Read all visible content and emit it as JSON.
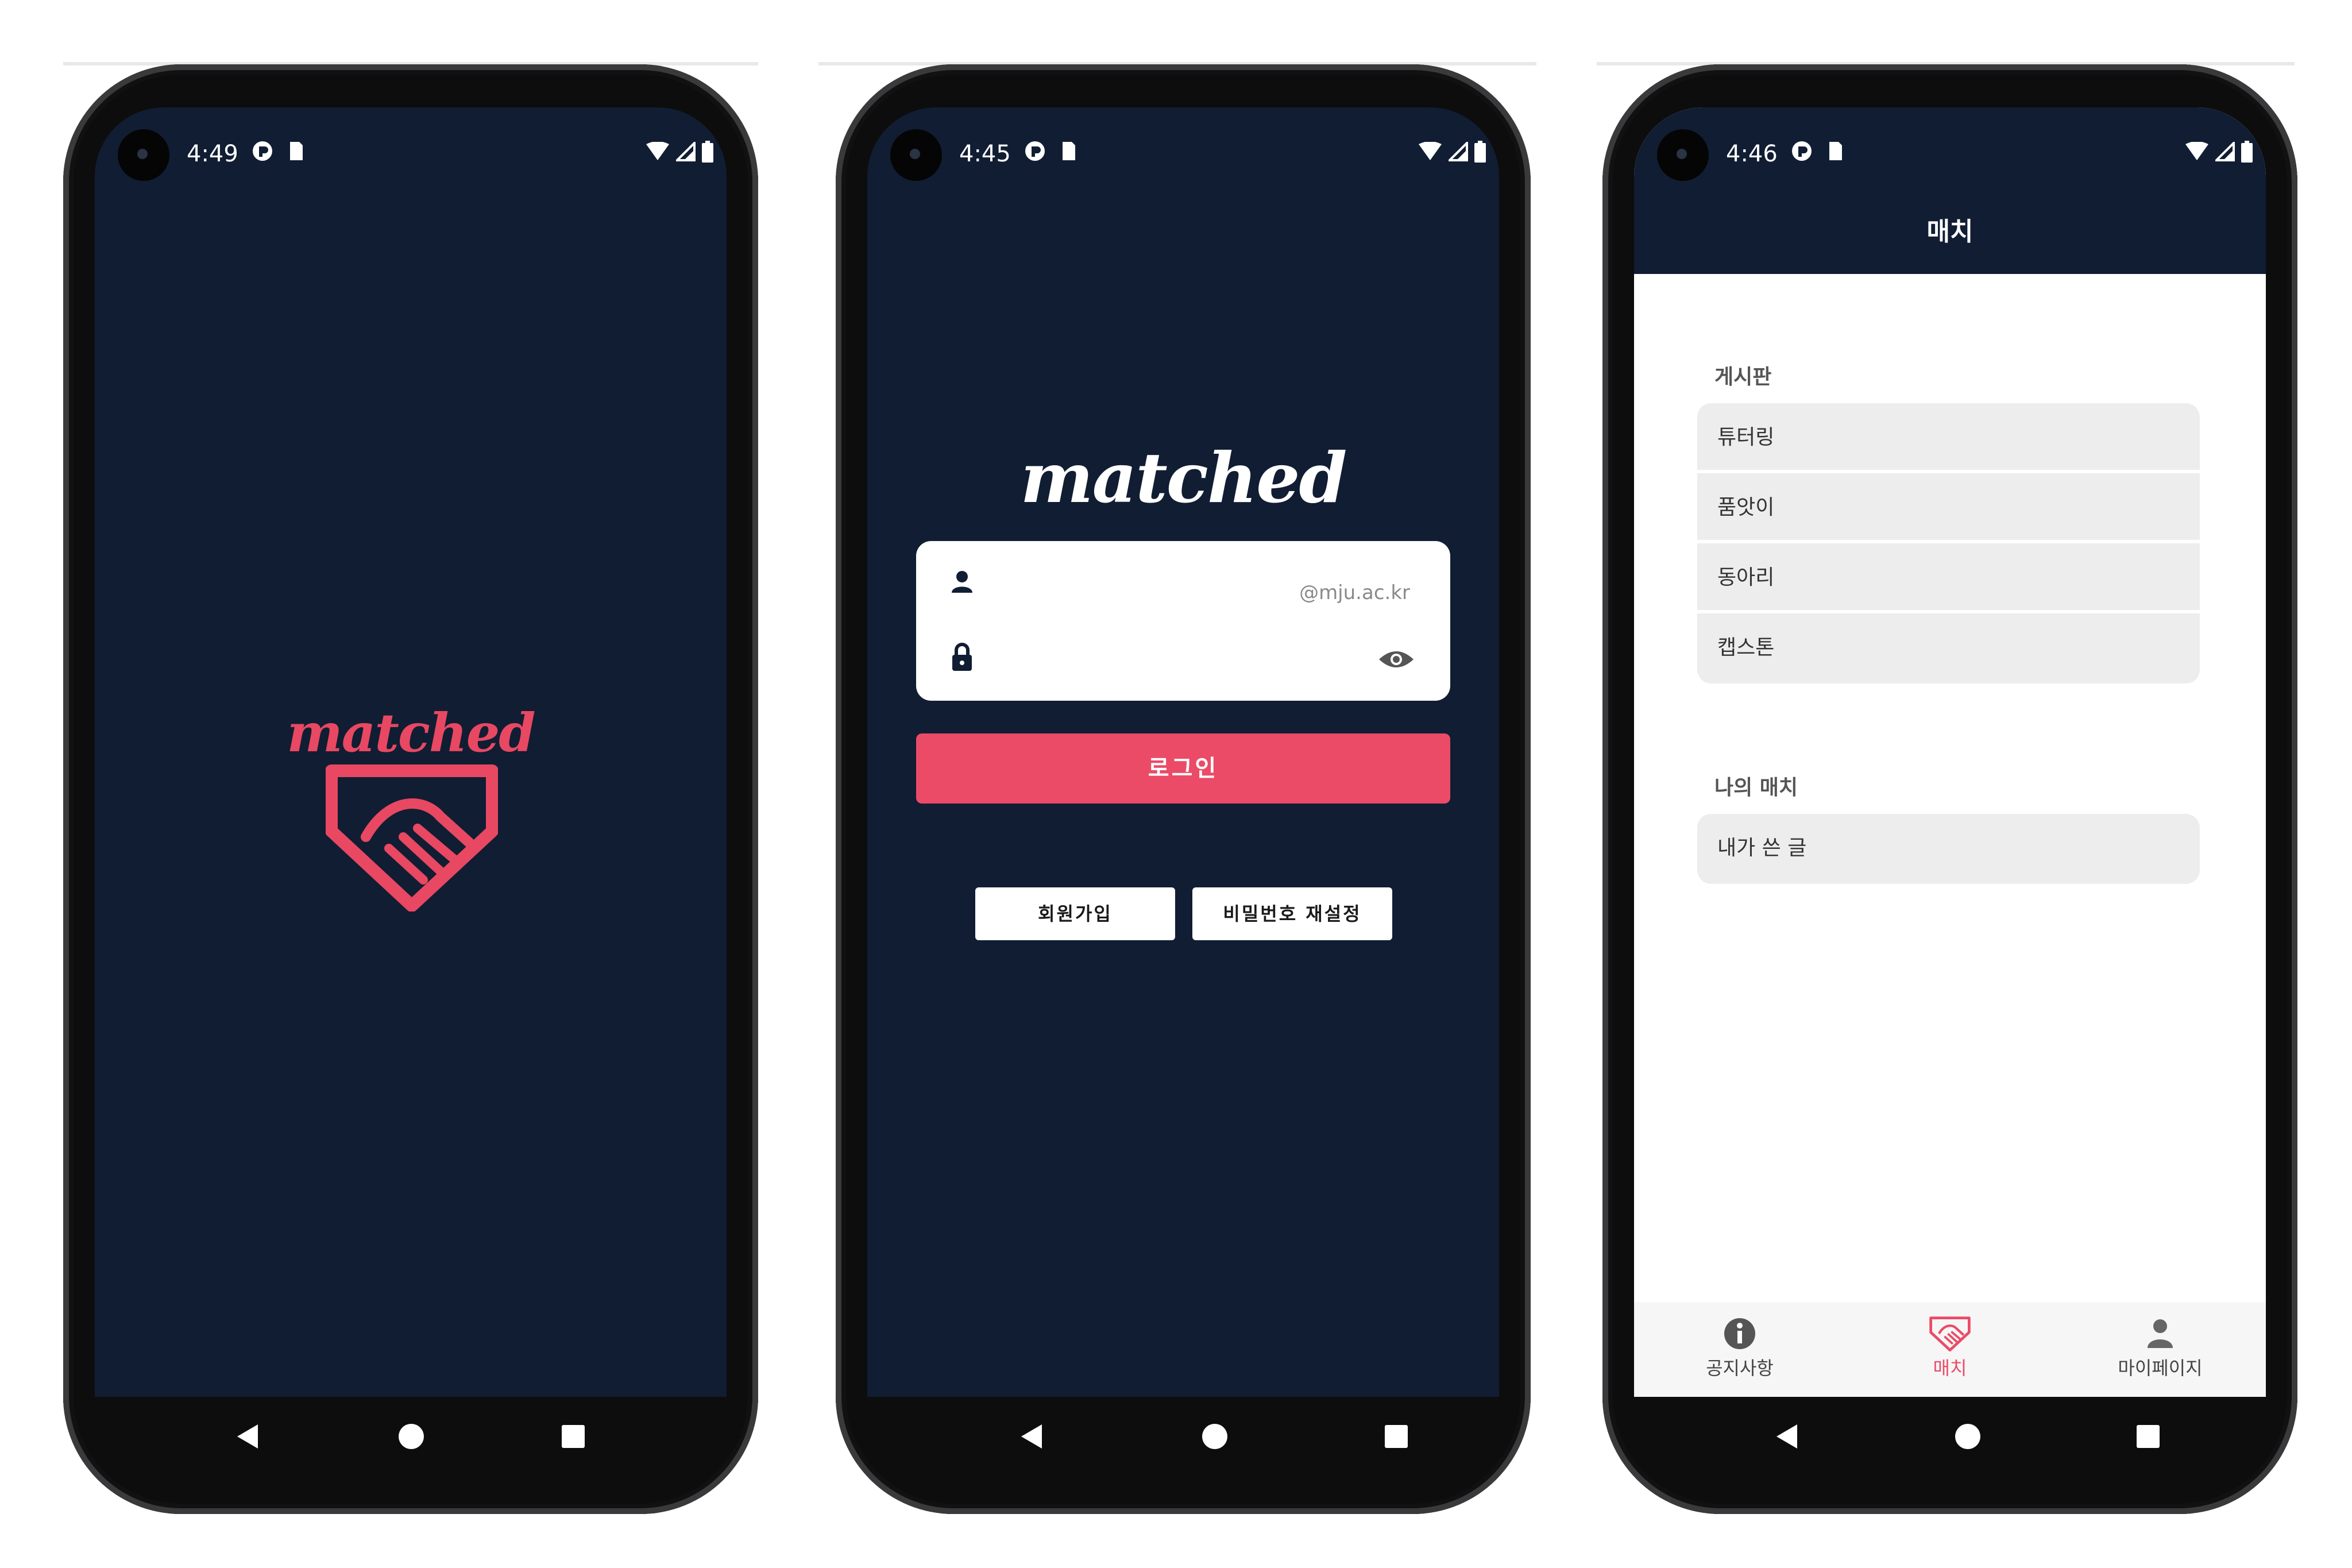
{
  "screens": [
    {
      "status": {
        "time": "4:49"
      },
      "splash": {
        "logo_text": "matched"
      }
    },
    {
      "status": {
        "time": "4:45"
      },
      "login": {
        "logo_text": "matched",
        "email_hint": "@mju.ac.kr",
        "login_label": "로그인",
        "signup_label": "회원가입",
        "reset_label": "비밀번호 재설정"
      }
    },
    {
      "status": {
        "time": "4:46"
      },
      "header_title": "매치",
      "board_title": "게시판",
      "board_items": [
        "튜터링",
        "품앗이",
        "동아리",
        "캡스톤"
      ],
      "mymatch_title": "나의 매치",
      "mymatch_items": [
        "내가 쓴 글"
      ],
      "tabs": [
        "공지사항",
        "매치",
        "마이페이지"
      ],
      "active_tab": "매치"
    }
  ],
  "colors": {
    "navy": "#111d33",
    "accent": "#eb4b67",
    "white": "#ffffff"
  },
  "icons": [
    "user-icon",
    "lock-icon",
    "eye-icon",
    "info-icon",
    "handshake-icon",
    "person-icon",
    "back-icon",
    "home-icon",
    "recents-icon",
    "wifi-icon",
    "signal-icon",
    "battery-icon"
  ]
}
